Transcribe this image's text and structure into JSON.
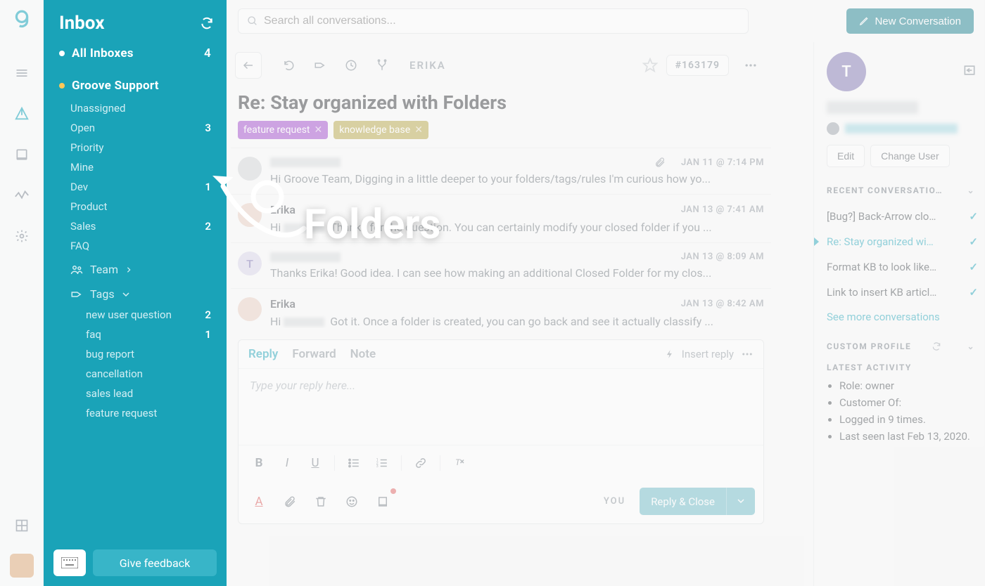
{
  "header": {
    "search_placeholder": "Search all conversations...",
    "new_conversation_label": "New Conversation"
  },
  "sidebar": {
    "title": "Inbox",
    "all_inboxes": {
      "label": "All Inboxes",
      "count": "4"
    },
    "mailbox": {
      "label": "Groove Support"
    },
    "folders": [
      {
        "label": "Unassigned",
        "count": ""
      },
      {
        "label": "Open",
        "count": "3"
      },
      {
        "label": "Priority",
        "count": ""
      },
      {
        "label": "Mine",
        "count": ""
      },
      {
        "label": "Dev",
        "count": "1"
      },
      {
        "label": "Product",
        "count": ""
      },
      {
        "label": "Sales",
        "count": "2"
      },
      {
        "label": "FAQ",
        "count": ""
      }
    ],
    "team_label": "Team",
    "tags_label": "Tags",
    "tags": [
      {
        "label": "new user question",
        "count": "2"
      },
      {
        "label": "faq",
        "count": "1"
      },
      {
        "label": "bug report",
        "count": ""
      },
      {
        "label": "cancellation",
        "count": ""
      },
      {
        "label": "sales lead",
        "count": ""
      },
      {
        "label": "feature request",
        "count": ""
      }
    ],
    "feedback_label": "Give feedback"
  },
  "conversation": {
    "assignee": "ERIKA",
    "id": "#163179",
    "title": "Re: Stay organized with Folders",
    "tags": [
      {
        "color": "purple",
        "label": "feature request"
      },
      {
        "color": "olive",
        "label": "knowledge base"
      }
    ],
    "messages": [
      {
        "name": "",
        "ts": "JAN 11 @ 7:14 PM",
        "has_attachment": true,
        "body": "Hi Groove Team, Digging in a little deeper to your folders/tags/rules I'm curious how yo..."
      },
      {
        "name": "Erika",
        "ts": "JAN 13 @ 7:41 AM",
        "body": "Hi      Thanks for the question. You can certainly modify your closed folder if you ..."
      },
      {
        "name": "",
        "avatar": "T",
        "ts": "JAN 13 @ 8:09 AM",
        "body": "Thanks Erika! Good idea.  I can see how making an additional Closed Folder for my clos..."
      },
      {
        "name": "Erika",
        "ts": "JAN 13 @ 8:42 AM",
        "body": "Hi      Got it. Once a folder is created, you can go back and see it actually classify ..."
      }
    ]
  },
  "reply": {
    "tabs": {
      "reply": "Reply",
      "forward": "Forward",
      "note": "Note"
    },
    "insert_reply": "Insert reply",
    "placeholder": "Type your reply here...",
    "you_label": "YOU",
    "reply_close": "Reply & Close"
  },
  "right_panel": {
    "avatar_initial": "T",
    "edit_label": "Edit",
    "change_user_label": "Change User",
    "recent_title": "RECENT CONVERSATIO…",
    "conversations": [
      {
        "label": "[Bug?] Back-Arrow clo…",
        "active": false
      },
      {
        "label": "Re: Stay organized wi…",
        "active": true
      },
      {
        "label": "Format KB to look like…",
        "active": false
      },
      {
        "label": "Link to insert KB articl…",
        "active": false
      }
    ],
    "see_more": "See more conversations",
    "custom_profile_title": "CUSTOM PROFILE",
    "latest_title": "LATEST ACTIVITY",
    "latest_items": [
      "Role: owner",
      "Customer Of:",
      "Logged in 9 times.",
      "Last seen last Feb 13, 2020."
    ]
  },
  "annotation": {
    "label": "Folders"
  }
}
